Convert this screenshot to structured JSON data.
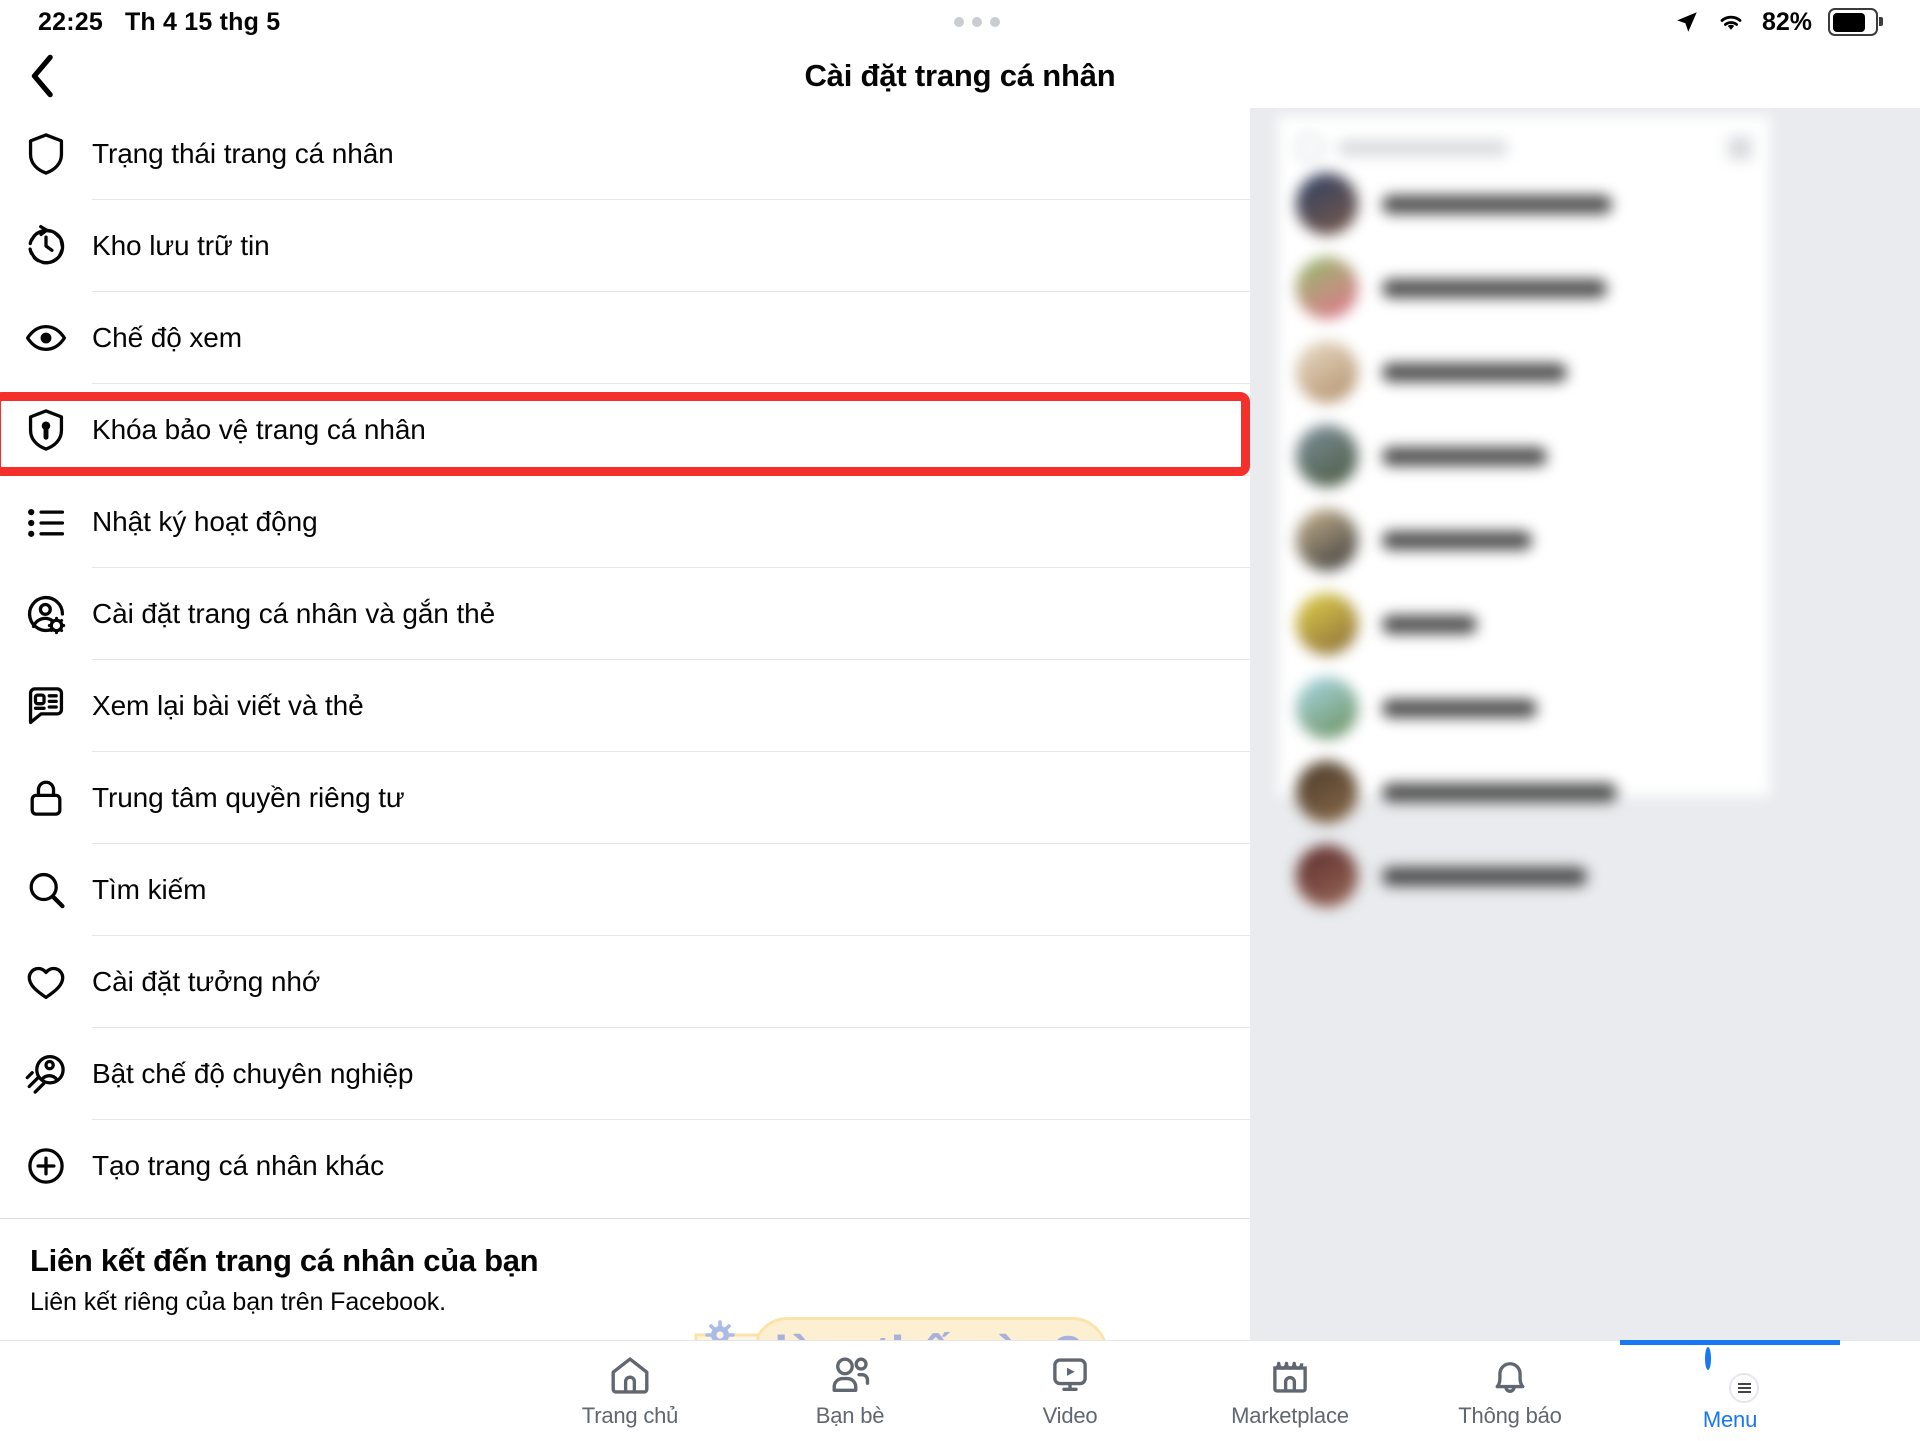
{
  "statusbar": {
    "time": "22:25",
    "date": "Th 4 15 thg 5",
    "battery_percent": "82%",
    "location_icon": "location-arrow-icon",
    "wifi_icon": "wifi-icon",
    "battery_icon": "battery-icon"
  },
  "header": {
    "back_icon": "back-chevron-icon",
    "title": "Cài đặt trang cá nhân"
  },
  "menu": {
    "items": [
      {
        "label": "Trạng thái trang cá nhân",
        "icon": "shield-icon"
      },
      {
        "label": "Kho lưu trữ tin",
        "icon": "clock-archive-icon"
      },
      {
        "label": "Chế độ xem",
        "icon": "eye-icon"
      },
      {
        "label": "Khóa bảo vệ trang cá nhân",
        "icon": "shield-lock-icon",
        "highlighted": true
      },
      {
        "label": "Nhật ký hoạt động",
        "icon": "list-icon"
      },
      {
        "label": "Cài đặt trang cá nhân và gắn thẻ",
        "icon": "profile-gear-icon"
      },
      {
        "label": "Xem lại bài viết và thẻ",
        "icon": "review-post-icon"
      },
      {
        "label": "Trung tâm quyền riêng tư",
        "icon": "lock-icon"
      },
      {
        "label": "Tìm kiếm",
        "icon": "search-icon"
      },
      {
        "label": "Cài đặt tưởng nhớ",
        "icon": "heart-icon"
      },
      {
        "label": "Bật chế độ chuyên nghiệp",
        "icon": "professional-mode-icon"
      },
      {
        "label": "Tạo trang cá nhân khác",
        "icon": "plus-circle-icon"
      }
    ],
    "highlight_color": "#f5302c"
  },
  "link_section": {
    "title": "Liên kết đến trang cá nhân của bạn",
    "subtitle": "Liên kết riêng của bạn trên Facebook."
  },
  "watermark": {
    "text": "làm thế nào?",
    "icon": "book-gear-icon"
  },
  "bottom_nav": {
    "items": [
      {
        "label": "Trang chủ",
        "icon": "home-icon",
        "active": false
      },
      {
        "label": "Bạn bè",
        "icon": "friends-icon",
        "active": false
      },
      {
        "label": "Video",
        "icon": "video-icon",
        "active": false
      },
      {
        "label": "Marketplace",
        "icon": "marketplace-icon",
        "active": false
      },
      {
        "label": "Thông báo",
        "icon": "bell-icon",
        "active": false
      },
      {
        "label": "Menu",
        "icon": "avatar-menu-icon",
        "active": true
      }
    ],
    "active_color": "#1877f2",
    "inactive_color": "#606770"
  },
  "right_panel": {
    "description": "blurred contacts list",
    "search_placeholder_blurred": true,
    "contacts": [
      {
        "name_blurred": true,
        "avatar_colors": [
          "#2d3f63",
          "#7b5a4a"
        ]
      },
      {
        "name_blurred": true,
        "avatar_colors": [
          "#8fbd6a",
          "#e5738f"
        ]
      },
      {
        "name_blurred": true,
        "avatar_colors": [
          "#e8dcc8",
          "#b38f6a"
        ]
      },
      {
        "name_blurred": true,
        "avatar_colors": [
          "#7e8f9d",
          "#4a5a3f"
        ]
      },
      {
        "name_blurred": true,
        "avatar_colors": [
          "#c8b48f",
          "#3a3a3a"
        ]
      },
      {
        "name_blurred": true,
        "avatar_colors": [
          "#e0d24a",
          "#8a6a3a"
        ]
      },
      {
        "name_blurred": true,
        "avatar_colors": [
          "#a9d8e8",
          "#6a8f5a"
        ]
      },
      {
        "name_blurred": true,
        "avatar_colors": [
          "#4a3a2a",
          "#8a6a4a"
        ]
      },
      {
        "name_blurred": true,
        "avatar_colors": [
          "#5a2a2a",
          "#9a6a5a"
        ]
      }
    ]
  }
}
